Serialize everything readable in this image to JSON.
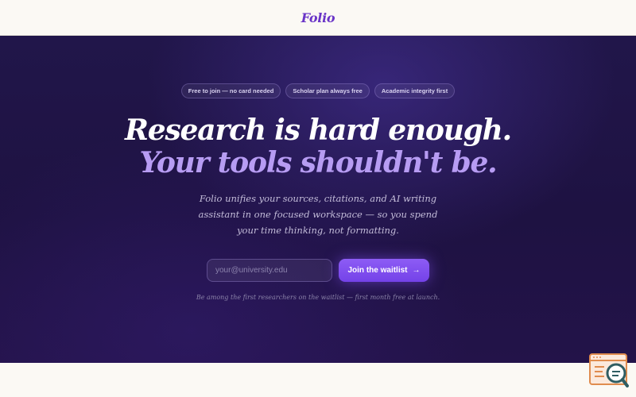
{
  "header": {
    "logo": "Folio"
  },
  "hero": {
    "pills": [
      "Free to join — no card needed",
      "Scholar plan always free",
      "Academic integrity first"
    ],
    "headline_line1": "Research is hard enough.",
    "headline_line2": "Your tools shouldn't be.",
    "subcopy": "Folio unifies your sources, citations, and AI writing assistant in one focused workspace — so you spend your time thinking, not formatting.",
    "email_placeholder": "your@university.edu",
    "cta_label": "Join the waitlist",
    "cta_icon": "arrow-right-icon",
    "note": "Be among the first researchers on the waitlist — first month free at launch."
  },
  "widget": {
    "icon": "page-search-icon"
  },
  "colors": {
    "accent": "#7c4de9",
    "headline_highlight": "#b79cf3",
    "hero_bg": "#21164a",
    "page_bg": "#fbf9f4"
  }
}
